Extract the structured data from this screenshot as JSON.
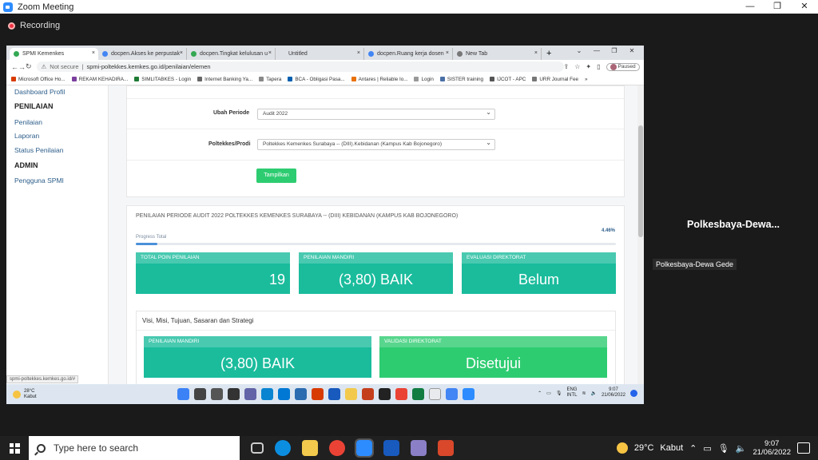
{
  "zoom": {
    "title": "Zoom Meeting",
    "recording": "Recording",
    "participant_big": "Polkesbaya-Dewa...",
    "participant_tag": "Polkesbaya-Dewa Gede"
  },
  "browser": {
    "tabs": [
      {
        "label": "SPMI Kemenkes",
        "color": "#34a853"
      },
      {
        "label": "docpen.Akses ke perpustak",
        "color": "#4285f4"
      },
      {
        "label": "docpen.Tingkat kelulusan u",
        "color": "#34a853"
      },
      {
        "label": "Untitled",
        "color": ""
      },
      {
        "label": "docpen.Ruang kerja dosen",
        "color": "#4285f4"
      },
      {
        "label": "New Tab",
        "color": "#777"
      }
    ],
    "security": "Not secure",
    "url": "spmi-poltekkes.kemkes.go.id/penilaian/elemen",
    "profile_status": "Paused",
    "bookmarks": [
      {
        "label": "Microsoft Office Ho...",
        "color": "#d83b01"
      },
      {
        "label": "REKAM KEHADIRA...",
        "color": "#7b3f9e"
      },
      {
        "label": "SIMLITABKES - Login",
        "color": "#1e7b34"
      },
      {
        "label": "Internet Banking Ya...",
        "color": "#666"
      },
      {
        "label": "Tapera",
        "color": "#888"
      },
      {
        "label": "BCA - Obligasi Pasa...",
        "color": "#0060af"
      },
      {
        "label": "Antares | Reliable Io...",
        "color": "#e8710a"
      },
      {
        "label": "Login",
        "color": "#999"
      },
      {
        "label": "SISTER training",
        "color": "#4a6fa5"
      },
      {
        "label": "IJCOT - APC",
        "color": "#555"
      },
      {
        "label": "URR Journal Fee",
        "color": "#777"
      }
    ],
    "status_link": "spmi-poltekkes.kemkes.go.id/#"
  },
  "sidebar": {
    "dashboard": "Dashboard Profil",
    "section_penilaian": "PENILAIAN",
    "items": [
      "Penilaian",
      "Laporan",
      "Status Penilaian"
    ],
    "section_admin": "ADMIN",
    "admin_items": [
      "Pengguna SPMI"
    ]
  },
  "filter": {
    "periode_label": "Ubah Periode",
    "periode_value": "Audit 2022",
    "prodi_label": "Poltekkes/Prodi",
    "prodi_value": "Poltekkes Kemenkes Surabaya -- (DIII).Kebidanan (Kampus Kab Bojonegoro)",
    "submit": "Tampilkan"
  },
  "summary": {
    "title": "PENILAIAN PERIODE AUDIT 2022 POLTEKKES KEMENKES SURABAYA -- (DIII) KEBIDANAN (KAMPUS KAB BOJONEGORO)",
    "progress_label": "Progress Total",
    "progress_value": "4.46%",
    "progress_fraction": 0.0446,
    "cards": [
      {
        "header": "TOTAL POIN PENILAIAN",
        "value": "19"
      },
      {
        "header": "PENILAIAN MANDIRI",
        "value": "(3,80) BAIK"
      },
      {
        "header": "EVALUASI DIREKTORAT",
        "value": "Belum"
      }
    ]
  },
  "section": {
    "title": "Visi, Misi, Tujuan, Sasaran dan Strategi",
    "cards": [
      {
        "header": "PENILAIAN MANDIRI",
        "value": "(3,80) BAIK"
      },
      {
        "header": "VALIDASI DIREKTORAT",
        "value": "Disetujui"
      }
    ]
  },
  "inner_taskbar": {
    "temp": "28°C",
    "weather": "Kabut",
    "lang": "ENG",
    "lang2": "INTL",
    "time": "9:07",
    "date": "21/06/2022"
  },
  "taskbar": {
    "search_placeholder": "Type here to search",
    "temp": "29°C",
    "weather": "Kabut",
    "time": "9:07",
    "date": "21/06/2022"
  }
}
